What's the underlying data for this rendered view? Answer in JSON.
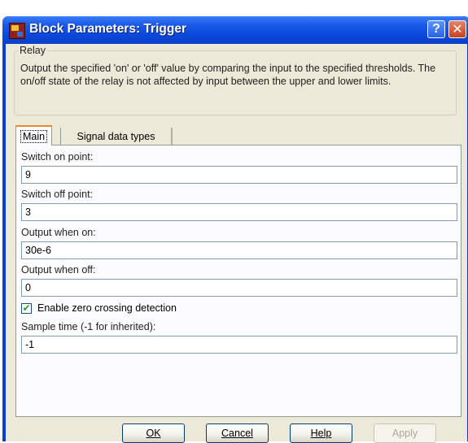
{
  "window": {
    "title": "Block Parameters: Trigger"
  },
  "titlebar_buttons": {
    "help": "?",
    "close": "✕"
  },
  "group": {
    "legend": "Relay",
    "description": "Output the specified 'on' or 'off' value by comparing the input to the specified thresholds.  The on/off state of the relay is not affected by input between the upper and lower limits."
  },
  "tabs": [
    {
      "label": "Main",
      "active": true
    },
    {
      "label": "Signal data types",
      "active": false
    }
  ],
  "params": {
    "switch_on": {
      "label": "Switch on point:",
      "value": "9"
    },
    "switch_off": {
      "label": "Switch off point:",
      "value": "3"
    },
    "output_on": {
      "label": "Output when on:",
      "value": "30e-6"
    },
    "output_off": {
      "label": "Output when off:",
      "value": "0"
    },
    "zero_crossing": {
      "label": "Enable zero crossing detection",
      "checked": true
    },
    "sample_time": {
      "label": "Sample time (-1 for inherited):",
      "value": "-1"
    }
  },
  "buttons": {
    "ok": "OK",
    "cancel": "Cancel",
    "help": "Help",
    "apply": "Apply"
  }
}
